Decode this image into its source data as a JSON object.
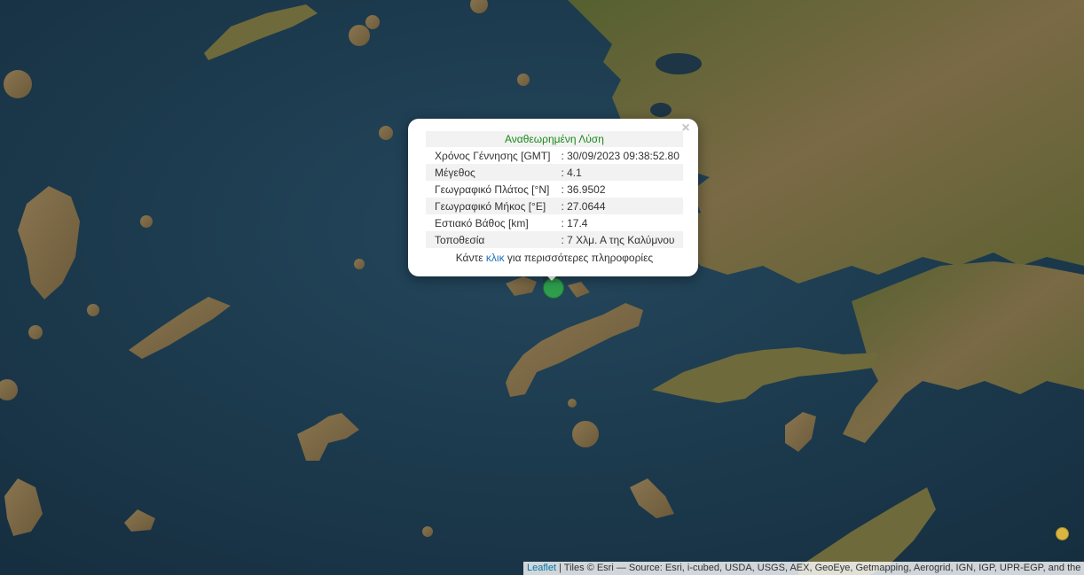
{
  "colors": {
    "sea": "#1b3a4f",
    "land": "#7a6a48",
    "forest": "#4e5a2f",
    "marker_main": "#2e9e4c",
    "marker_other": "#d8b640",
    "popup_title": "#1a8a1a",
    "link": "#1e6fb9"
  },
  "popup": {
    "title": "Αναθεωρημένη Λύση",
    "close_icon": "×",
    "rows": [
      {
        "label": "Χρόνος Γέννησης [GMT]",
        "value": ": 30/09/2023 09:38:52.80"
      },
      {
        "label": "Μέγεθος",
        "value": ": 4.1"
      },
      {
        "label": "Γεωγραφικό Πλάτος [°N]",
        "value": ": 36.9502"
      },
      {
        "label": "Γεωγραφικό Μήκος [°E]",
        "value": ": 27.0644"
      },
      {
        "label": "Εστιακό Βάθος [km]",
        "value": ": 17.4"
      },
      {
        "label": "Τοποθεσία",
        "value": ": 7 Χλμ. Α της Καλύμνου"
      }
    ],
    "more_prefix": "Κάντε ",
    "more_link": "κλικ",
    "more_suffix": " για περισσότερες πληροφορίες"
  },
  "markers": [
    {
      "name": "earthquake-marker-main",
      "color": "#2e9e4c",
      "magnitude": "4.1"
    },
    {
      "name": "earthquake-marker-other",
      "color": "#d8b640"
    }
  ],
  "attribution": {
    "leaflet": "Leaflet",
    "text": " | Tiles © Esri — Source: Esri, i-cubed, USDA, USGS, AEX, GeoEye, Getmapping, Aerogrid, IGN, IGP, UPR-EGP, and the GIS User Community"
  }
}
